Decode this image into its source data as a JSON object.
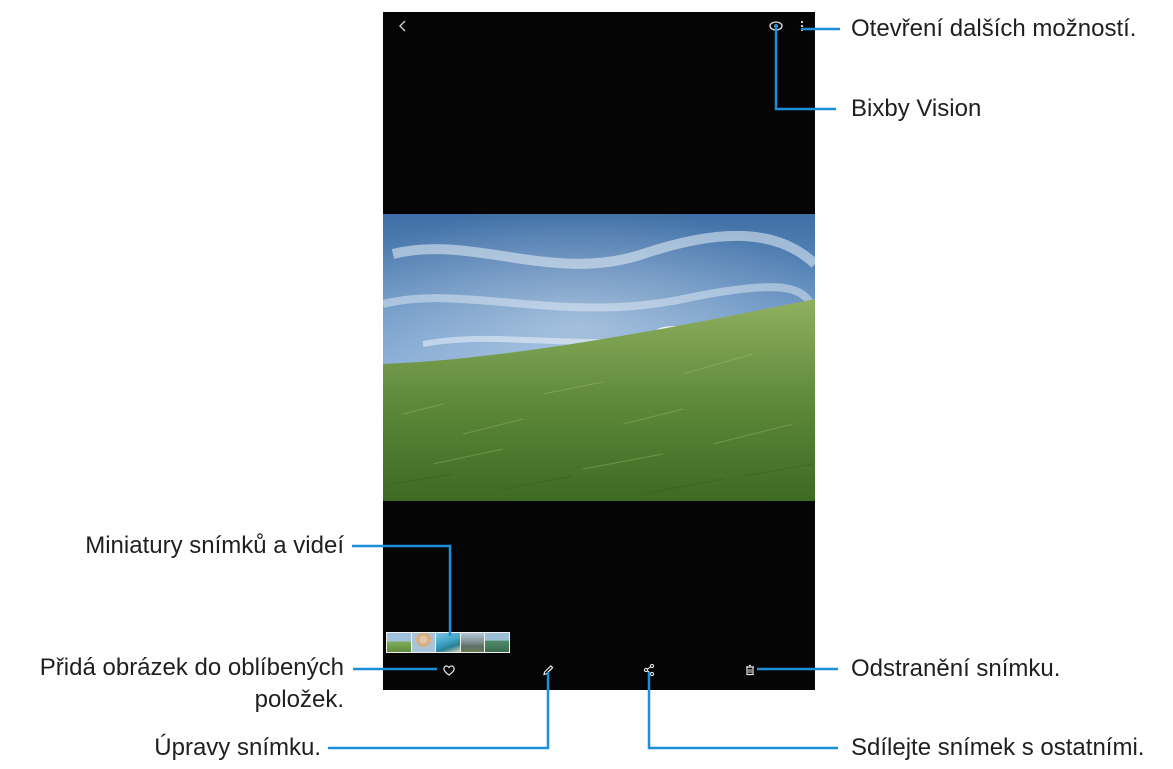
{
  "callouts": {
    "more_options": "Otevření dalších možností.",
    "bixby_vision": "Bixby Vision",
    "thumbnails": "Miniatury snímků a videí",
    "favorite_line1": "Přidá obrázek do oblíbených",
    "favorite_line2": "položek.",
    "delete": "Odstranění snímku.",
    "edit": "Úpravy snímku.",
    "share": "Sdílejte snímek s ostatními."
  },
  "icons": {
    "back": "back-arrow-icon",
    "bixby_vision": "eye-icon",
    "more": "more-vertical-icon",
    "favorite": "heart-icon",
    "edit": "pencil-icon",
    "share": "share-icon",
    "delete": "trash-icon"
  },
  "colors": {
    "callout_line": "#1c8fdc",
    "screen_bg": "#050505",
    "icon": "#cfcfcf"
  },
  "thumbnails": [
    {
      "name": "thumbnail-grass",
      "color": "#7fae5a"
    },
    {
      "name": "thumbnail-person",
      "color": "#c9a77e"
    },
    {
      "name": "thumbnail-coast",
      "color": "#3fa7c9"
    },
    {
      "name": "thumbnail-city",
      "color": "#6f8a8c"
    },
    {
      "name": "thumbnail-landscape",
      "color": "#4f8a6a"
    }
  ]
}
